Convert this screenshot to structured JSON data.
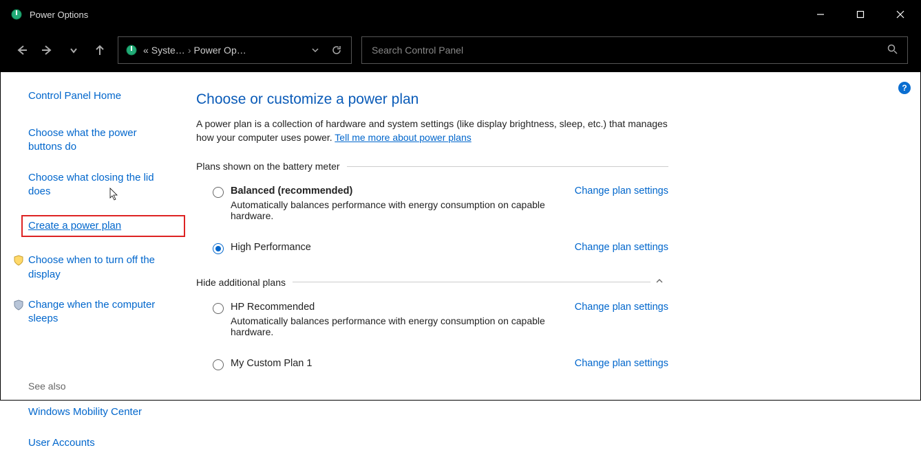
{
  "window": {
    "title": "Power Options"
  },
  "breadcrumb": {
    "prefix": "«",
    "part1": "Syste…",
    "part2": "Power Op…"
  },
  "search": {
    "placeholder": "Search Control Panel"
  },
  "sidebar": {
    "home": "Control Panel Home",
    "links": [
      "Choose what the power buttons do",
      "Choose what closing the lid does",
      "Create a power plan",
      "Choose when to turn off the display",
      "Change when the computer sleeps"
    ],
    "see_also_label": "See also",
    "see_also": [
      "Windows Mobility Center",
      "User Accounts"
    ]
  },
  "main": {
    "title": "Choose or customize a power plan",
    "desc_pre": "A power plan is a collection of hardware and system settings (like display brightness, sleep, etc.) that manages how your computer uses power. ",
    "desc_link": "Tell me more about power plans",
    "section1": "Plans shown on the battery meter",
    "section2": "Hide additional plans",
    "change_link": "Change plan settings",
    "plans_primary": [
      {
        "name": "Balanced (recommended)",
        "bold": true,
        "selected": false,
        "desc": "Automatically balances performance with energy consumption on capable hardware."
      },
      {
        "name": "High Performance",
        "bold": false,
        "selected": true,
        "desc": ""
      }
    ],
    "plans_additional": [
      {
        "name": "HP Recommended",
        "bold": false,
        "selected": false,
        "desc": "Automatically balances performance with energy consumption on capable hardware."
      },
      {
        "name": "My Custom Plan 1",
        "bold": false,
        "selected": false,
        "desc": ""
      }
    ],
    "help": "?"
  }
}
